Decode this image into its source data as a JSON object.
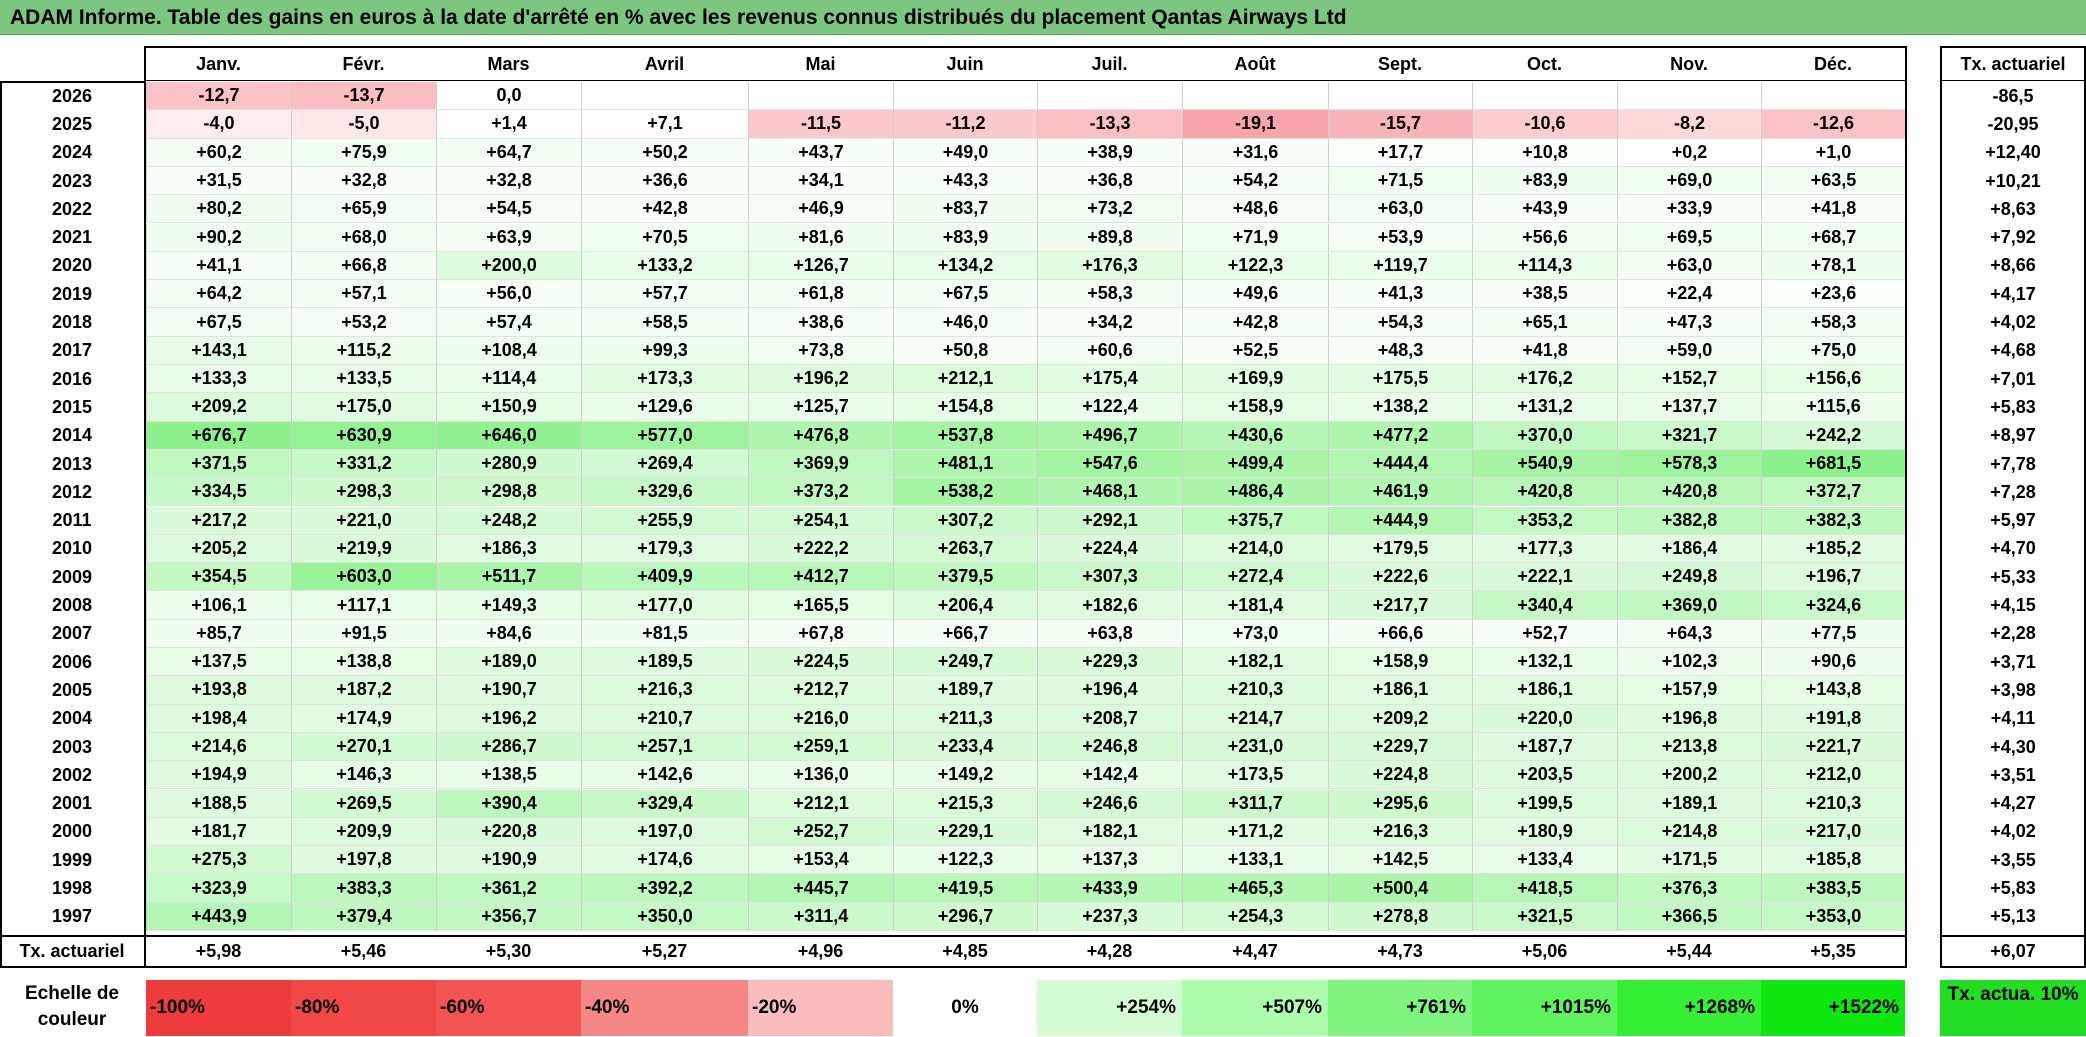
{
  "title": "ADAM Informe. Table des gains en euros à la date d'arrêté en % avec les revenus connus distribués du placement Qantas Airways Ltd",
  "months": [
    "Janv.",
    "Févr.",
    "Mars",
    "Avril",
    "Mai",
    "Juin",
    "Juil.",
    "Août",
    "Sept.",
    "Oct.",
    "Nov.",
    "Déc."
  ],
  "actuarial_col_header": "Tx. actuariel",
  "rows": [
    {
      "year": "2026",
      "values": [
        "-12,7",
        "-13,7",
        "0,0",
        "",
        "",
        "",
        "",
        "",
        "",
        "",
        "",
        ""
      ],
      "actuarial": "-86,5"
    },
    {
      "year": "2025",
      "values": [
        "-4,0",
        "-5,0",
        "+1,4",
        "+7,1",
        "-11,5",
        "-11,2",
        "-13,3",
        "-19,1",
        "-15,7",
        "-10,6",
        "-8,2",
        "-12,6"
      ],
      "actuarial": "-20,95"
    },
    {
      "year": "2024",
      "values": [
        "+60,2",
        "+75,9",
        "+64,7",
        "+50,2",
        "+43,7",
        "+49,0",
        "+38,9",
        "+31,6",
        "+17,7",
        "+10,8",
        "+0,2",
        "+1,0"
      ],
      "actuarial": "+12,40"
    },
    {
      "year": "2023",
      "values": [
        "+31,5",
        "+32,8",
        "+32,8",
        "+36,6",
        "+34,1",
        "+43,3",
        "+36,8",
        "+54,2",
        "+71,5",
        "+83,9",
        "+69,0",
        "+63,5"
      ],
      "actuarial": "+10,21"
    },
    {
      "year": "2022",
      "values": [
        "+80,2",
        "+65,9",
        "+54,5",
        "+42,8",
        "+46,9",
        "+83,7",
        "+73,2",
        "+48,6",
        "+63,0",
        "+43,9",
        "+33,9",
        "+41,8"
      ],
      "actuarial": "+8,63"
    },
    {
      "year": "2021",
      "values": [
        "+90,2",
        "+68,0",
        "+63,9",
        "+70,5",
        "+81,6",
        "+83,9",
        "+89,8",
        "+71,9",
        "+53,9",
        "+56,6",
        "+69,5",
        "+68,7"
      ],
      "actuarial": "+7,92"
    },
    {
      "year": "2020",
      "values": [
        "+41,1",
        "+66,8",
        "+200,0",
        "+133,2",
        "+126,7",
        "+134,2",
        "+176,3",
        "+122,3",
        "+119,7",
        "+114,3",
        "+63,0",
        "+78,1"
      ],
      "actuarial": "+8,66"
    },
    {
      "year": "2019",
      "values": [
        "+64,2",
        "+57,1",
        "+56,0",
        "+57,7",
        "+61,8",
        "+67,5",
        "+58,3",
        "+49,6",
        "+41,3",
        "+38,5",
        "+22,4",
        "+23,6"
      ],
      "actuarial": "+4,17"
    },
    {
      "year": "2018",
      "values": [
        "+67,5",
        "+53,2",
        "+57,4",
        "+58,5",
        "+38,6",
        "+46,0",
        "+34,2",
        "+42,8",
        "+54,3",
        "+65,1",
        "+47,3",
        "+58,3"
      ],
      "actuarial": "+4,02"
    },
    {
      "year": "2017",
      "values": [
        "+143,1",
        "+115,2",
        "+108,4",
        "+99,3",
        "+73,8",
        "+50,8",
        "+60,6",
        "+52,5",
        "+48,3",
        "+41,8",
        "+59,0",
        "+75,0"
      ],
      "actuarial": "+4,68"
    },
    {
      "year": "2016",
      "values": [
        "+133,3",
        "+133,5",
        "+114,4",
        "+173,3",
        "+196,2",
        "+212,1",
        "+175,4",
        "+169,9",
        "+175,5",
        "+176,2",
        "+152,7",
        "+156,6"
      ],
      "actuarial": "+7,01"
    },
    {
      "year": "2015",
      "values": [
        "+209,2",
        "+175,0",
        "+150,9",
        "+129,6",
        "+125,7",
        "+154,8",
        "+122,4",
        "+158,9",
        "+138,2",
        "+131,2",
        "+137,7",
        "+115,6"
      ],
      "actuarial": "+5,83"
    },
    {
      "year": "2014",
      "values": [
        "+676,7",
        "+630,9",
        "+646,0",
        "+577,0",
        "+476,8",
        "+537,8",
        "+496,7",
        "+430,6",
        "+477,2",
        "+370,0",
        "+321,7",
        "+242,2"
      ],
      "actuarial": "+8,97"
    },
    {
      "year": "2013",
      "values": [
        "+371,5",
        "+331,2",
        "+280,9",
        "+269,4",
        "+369,9",
        "+481,1",
        "+547,6",
        "+499,4",
        "+444,4",
        "+540,9",
        "+578,3",
        "+681,5"
      ],
      "actuarial": "+7,78"
    },
    {
      "year": "2012",
      "values": [
        "+334,5",
        "+298,3",
        "+298,8",
        "+329,6",
        "+373,2",
        "+538,2",
        "+468,1",
        "+486,4",
        "+461,9",
        "+420,8",
        "+420,8",
        "+372,7"
      ],
      "actuarial": "+7,28"
    },
    {
      "year": "2011",
      "values": [
        "+217,2",
        "+221,0",
        "+248,2",
        "+255,9",
        "+254,1",
        "+307,2",
        "+292,1",
        "+375,7",
        "+444,9",
        "+353,2",
        "+382,8",
        "+382,3"
      ],
      "actuarial": "+5,97"
    },
    {
      "year": "2010",
      "values": [
        "+205,2",
        "+219,9",
        "+186,3",
        "+179,3",
        "+222,2",
        "+263,7",
        "+224,4",
        "+214,0",
        "+179,5",
        "+177,3",
        "+186,4",
        "+185,2"
      ],
      "actuarial": "+4,70"
    },
    {
      "year": "2009",
      "values": [
        "+354,5",
        "+603,0",
        "+511,7",
        "+409,9",
        "+412,7",
        "+379,5",
        "+307,3",
        "+272,4",
        "+222,6",
        "+222,1",
        "+249,8",
        "+196,7"
      ],
      "actuarial": "+5,33"
    },
    {
      "year": "2008",
      "values": [
        "+106,1",
        "+117,1",
        "+149,3",
        "+177,0",
        "+165,5",
        "+206,4",
        "+182,6",
        "+181,4",
        "+217,7",
        "+340,4",
        "+369,0",
        "+324,6"
      ],
      "actuarial": "+4,15"
    },
    {
      "year": "2007",
      "values": [
        "+85,7",
        "+91,5",
        "+84,6",
        "+81,5",
        "+67,8",
        "+66,7",
        "+63,8",
        "+73,0",
        "+66,6",
        "+52,7",
        "+64,3",
        "+77,5"
      ],
      "actuarial": "+2,28"
    },
    {
      "year": "2006",
      "values": [
        "+137,5",
        "+138,8",
        "+189,0",
        "+189,5",
        "+224,5",
        "+249,7",
        "+229,3",
        "+182,1",
        "+158,9",
        "+132,1",
        "+102,3",
        "+90,6"
      ],
      "actuarial": "+3,71"
    },
    {
      "year": "2005",
      "values": [
        "+193,8",
        "+187,2",
        "+190,7",
        "+216,3",
        "+212,7",
        "+189,7",
        "+196,4",
        "+210,3",
        "+186,1",
        "+186,1",
        "+157,9",
        "+143,8"
      ],
      "actuarial": "+3,98"
    },
    {
      "year": "2004",
      "values": [
        "+198,4",
        "+174,9",
        "+196,2",
        "+210,7",
        "+216,0",
        "+211,3",
        "+208,7",
        "+214,7",
        "+209,2",
        "+220,0",
        "+196,8",
        "+191,8"
      ],
      "actuarial": "+4,11"
    },
    {
      "year": "2003",
      "values": [
        "+214,6",
        "+270,1",
        "+286,7",
        "+257,1",
        "+259,1",
        "+233,4",
        "+246,8",
        "+231,0",
        "+229,7",
        "+187,7",
        "+213,8",
        "+221,7"
      ],
      "actuarial": "+4,30"
    },
    {
      "year": "2002",
      "values": [
        "+194,9",
        "+146,3",
        "+138,5",
        "+142,6",
        "+136,0",
        "+149,2",
        "+142,4",
        "+173,5",
        "+224,8",
        "+203,5",
        "+200,2",
        "+212,0"
      ],
      "actuarial": "+3,51"
    },
    {
      "year": "2001",
      "values": [
        "+188,5",
        "+269,5",
        "+390,4",
        "+329,4",
        "+212,1",
        "+215,3",
        "+246,6",
        "+311,7",
        "+295,6",
        "+199,5",
        "+189,1",
        "+210,3"
      ],
      "actuarial": "+4,27"
    },
    {
      "year": "2000",
      "values": [
        "+181,7",
        "+209,9",
        "+220,8",
        "+197,0",
        "+252,7",
        "+229,1",
        "+182,1",
        "+171,2",
        "+216,3",
        "+180,9",
        "+214,8",
        "+217,0"
      ],
      "actuarial": "+4,02"
    },
    {
      "year": "1999",
      "values": [
        "+275,3",
        "+197,8",
        "+190,9",
        "+174,6",
        "+153,4",
        "+122,3",
        "+137,3",
        "+133,1",
        "+142,5",
        "+133,4",
        "+171,5",
        "+185,8"
      ],
      "actuarial": "+3,55"
    },
    {
      "year": "1998",
      "values": [
        "+323,9",
        "+383,3",
        "+361,2",
        "+392,2",
        "+445,7",
        "+419,5",
        "+433,9",
        "+465,3",
        "+500,4",
        "+418,5",
        "+376,3",
        "+383,5"
      ],
      "actuarial": "+5,83"
    },
    {
      "year": "1997",
      "values": [
        "+443,9",
        "+379,4",
        "+356,7",
        "+350,0",
        "+311,4",
        "+296,7",
        "+237,3",
        "+254,3",
        "+278,8",
        "+321,5",
        "+366,5",
        "+353,0"
      ],
      "actuarial": "+5,13"
    }
  ],
  "footer": {
    "label": "Tx. actuariel",
    "values": [
      "+5,98",
      "+5,46",
      "+5,30",
      "+5,27",
      "+4,96",
      "+4,85",
      "+4,28",
      "+4,47",
      "+4,73",
      "+5,06",
      "+5,44",
      "+5,35"
    ],
    "total": "+6,07"
  },
  "color_scale": {
    "label": "Echelle de couleur",
    "steps": [
      {
        "label": "-100%",
        "color": "#ee3b3b"
      },
      {
        "label": "-80%",
        "color": "#f04747"
      },
      {
        "label": "-60%",
        "color": "#f25454"
      },
      {
        "label": "-40%",
        "color": "#f58787"
      },
      {
        "label": "-20%",
        "color": "#fabcbc"
      },
      {
        "label": "0%",
        "color": "#ffffff"
      },
      {
        "label": "+254%",
        "color": "#d4fdd4"
      },
      {
        "label": "+507%",
        "color": "#aefcae"
      },
      {
        "label": "+761%",
        "color": "#7ff57f"
      },
      {
        "label": "+1015%",
        "color": "#5ef25e"
      },
      {
        "label": "+1268%",
        "color": "#36ee36"
      },
      {
        "label": "+1522%",
        "color": "#10e610"
      }
    ],
    "actuarial_label": "Tx. actua. 10%",
    "actuarial_color": "#22dd22"
  }
}
